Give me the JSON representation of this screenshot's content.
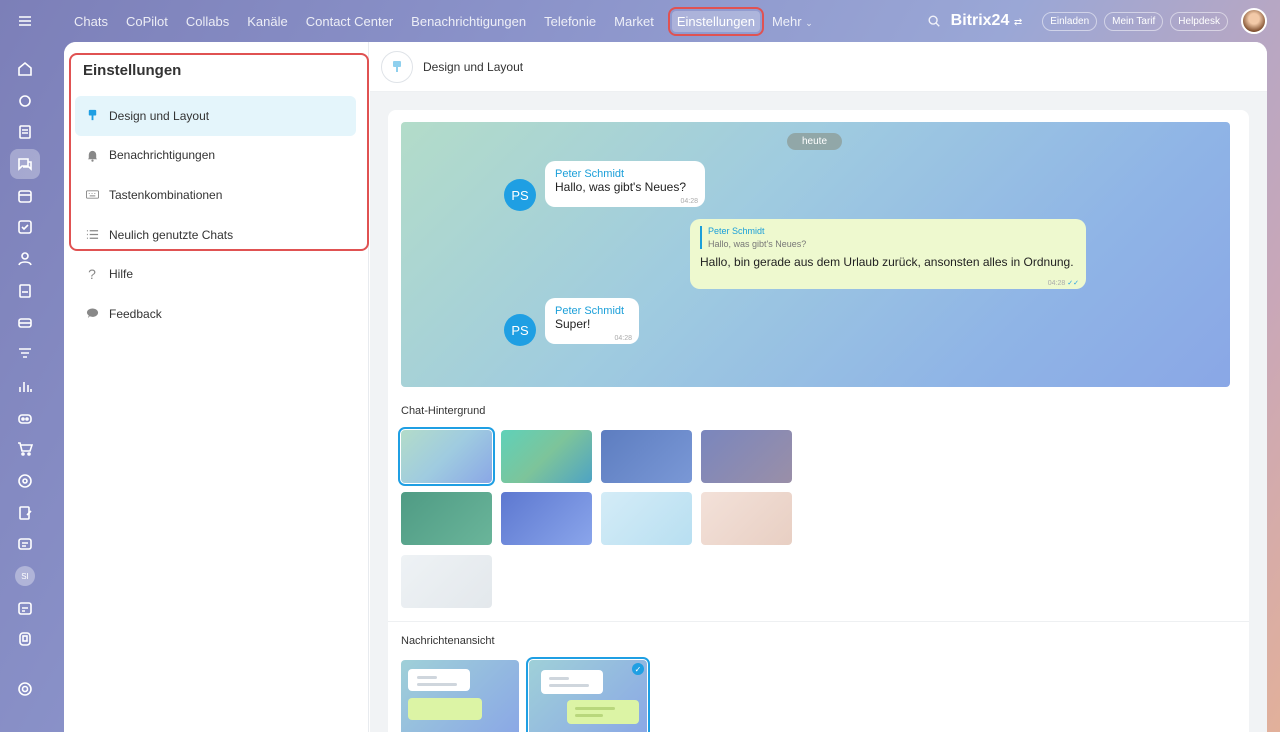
{
  "nav": {
    "items": [
      "Chats",
      "CoPilot",
      "Collabs",
      "Kanäle",
      "Contact Center",
      "Benachrichtigungen",
      "Telefonie",
      "Market",
      "Einstellungen",
      "Mehr"
    ],
    "active": "Einstellungen"
  },
  "header": {
    "brand": "Bitrix24",
    "invite": "Einladen",
    "tariff": "Mein Tarif",
    "helpdesk": "Helpdesk"
  },
  "rail": {
    "icons": [
      "menu-icon",
      "home-icon",
      "copilot-icon",
      "feed-icon",
      "chat-icon",
      "calendar-icon",
      "tasks-icon",
      "contacts-icon",
      "docs-icon",
      "crm-icon",
      "filter-icon",
      "analytics-icon",
      "robot-icon",
      "shop-icon",
      "target-icon",
      "sign-icon",
      "card-icon",
      "avatar-icon",
      "planner-icon",
      "box-icon",
      "settings-icon"
    ],
    "si_label": "SI"
  },
  "sidebar": {
    "title": "Einstellungen",
    "items": [
      {
        "label": "Design und Layout",
        "icon": "brush-icon"
      },
      {
        "label": "Benachrichtigungen",
        "icon": "bell-icon"
      },
      {
        "label": "Tastenkombinationen",
        "icon": "keyboard-icon"
      },
      {
        "label": "Neulich genutzte Chats",
        "icon": "list-icon"
      },
      {
        "label": "Hilfe",
        "icon": "question-icon"
      },
      {
        "label": "Feedback",
        "icon": "speech-bubble-icon"
      }
    ]
  },
  "content": {
    "title": "Design und Layout",
    "preview": {
      "date": "heute",
      "msg1": {
        "initials": "PS",
        "name": "Peter Schmidt",
        "text": "Hallo, was gibt's Neues?",
        "time": "04:28"
      },
      "msg2": {
        "quote_name": "Peter Schmidt",
        "quote_text": "Hallo, was gibt's Neues?",
        "text": "Hallo, bin gerade aus dem Urlaub zurück, ansonsten alles in Ordnung.",
        "time": "04:28"
      },
      "msg3": {
        "initials": "PS",
        "name": "Peter Schmidt",
        "text": "Super!",
        "time": "04:28"
      }
    },
    "background_label": "Chat-Hintergrund",
    "backgrounds": [
      "#a6cfe0",
      "#6cc2a8",
      "#6b86c9",
      "#8a8ab3",
      "#5fa88e",
      "#6f8fe0",
      "#c2e4f3",
      "#f0d8cf",
      "#e8eef2"
    ],
    "selected_background": 0,
    "view_label": "Nachrichtenansicht",
    "selected_view": 1
  }
}
